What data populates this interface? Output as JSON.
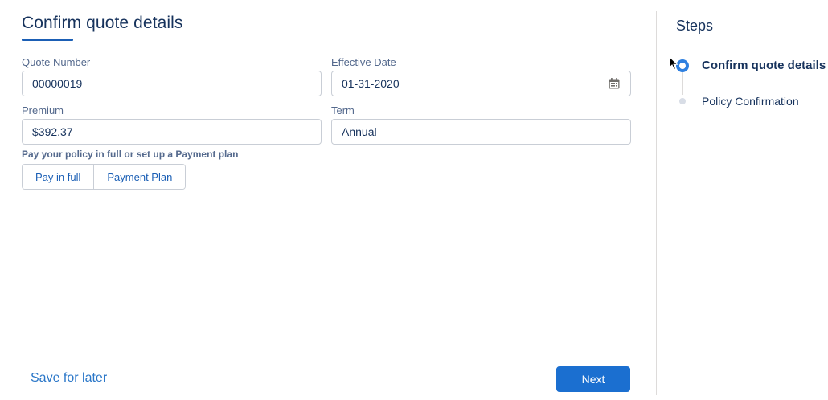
{
  "page": {
    "title": "Confirm quote details"
  },
  "form": {
    "quote_number": {
      "label": "Quote Number",
      "value": "00000019"
    },
    "effective_date": {
      "label": "Effective Date",
      "value": "01-31-2020",
      "icon": "calendar-icon"
    },
    "premium": {
      "label": "Premium",
      "value": "$392.37"
    },
    "term": {
      "label": "Term",
      "value": "Annual"
    },
    "payment_prompt": "Pay your policy in full or set up a Payment plan",
    "payment_options": [
      "Pay in full",
      "Payment Plan"
    ]
  },
  "footer": {
    "save_later": "Save for later",
    "next": "Next"
  },
  "steps": {
    "title": "Steps",
    "items": [
      {
        "label": "Confirm quote details",
        "state": "current"
      },
      {
        "label": "Policy Confirmation",
        "state": "upcoming"
      }
    ]
  },
  "colors": {
    "brand": "#1b6fd0",
    "link": "#2b77c8",
    "title": "#16325c",
    "active_step": "#2f80e0"
  }
}
